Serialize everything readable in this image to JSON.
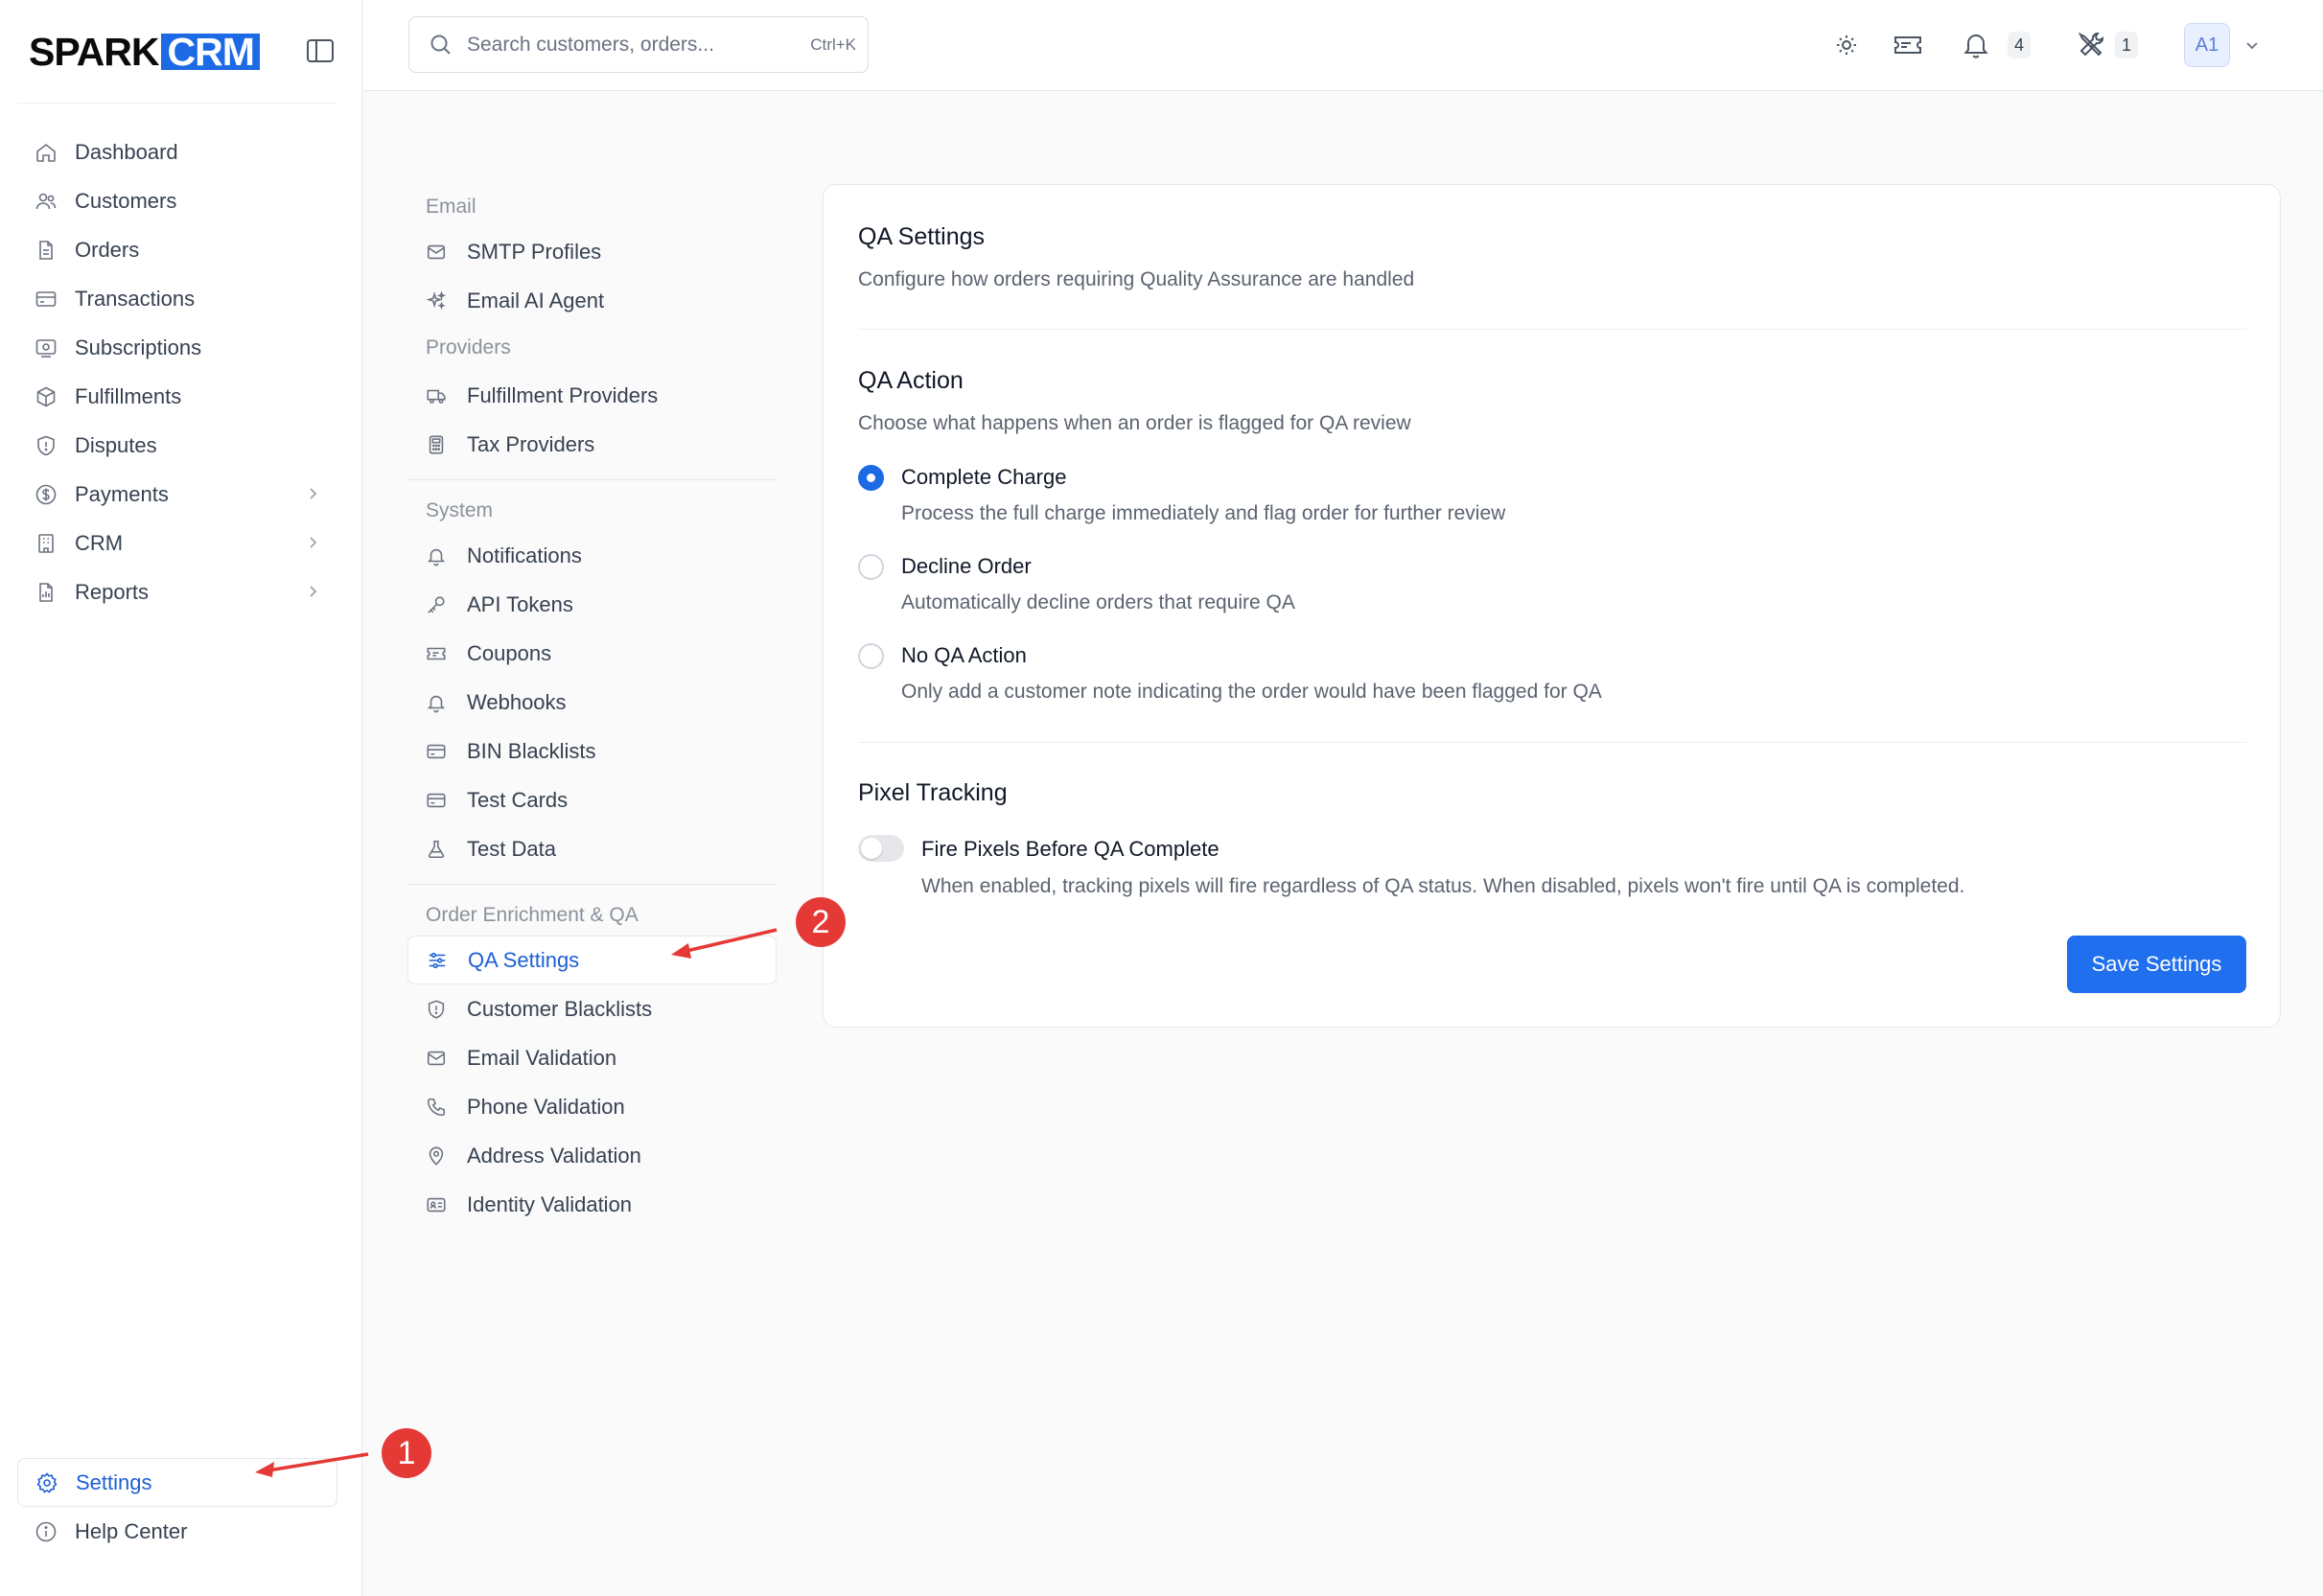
{
  "brand": {
    "logo_left": "SPARK",
    "logo_right": "CRM",
    "accent": "#1d6ae5"
  },
  "sidebar": {
    "items": [
      {
        "label": "Dashboard",
        "icon": "home-icon"
      },
      {
        "label": "Customers",
        "icon": "users-icon"
      },
      {
        "label": "Orders",
        "icon": "file-icon"
      },
      {
        "label": "Transactions",
        "icon": "credit-card-icon"
      },
      {
        "label": "Subscriptions",
        "icon": "refresh-card-icon"
      },
      {
        "label": "Fulfillments",
        "icon": "box-icon"
      },
      {
        "label": "Disputes",
        "icon": "shield-icon"
      },
      {
        "label": "Payments",
        "icon": "dollar-icon",
        "expandable": true
      },
      {
        "label": "CRM",
        "icon": "building-icon",
        "expandable": true
      },
      {
        "label": "Reports",
        "icon": "report-icon",
        "expandable": true
      }
    ],
    "bottom": [
      {
        "label": "Settings",
        "icon": "gear-icon",
        "active": true
      },
      {
        "label": "Help Center",
        "icon": "info-icon"
      }
    ]
  },
  "header": {
    "search_placeholder": "Search customers, orders...",
    "search_shortcut": "Ctrl+K",
    "notifications_count": "4",
    "tools_count": "1",
    "avatar_initials": "A1"
  },
  "settings_nav": {
    "groups": [
      {
        "title": "Email",
        "items": [
          {
            "label": "SMTP Profiles",
            "icon": "mail-icon"
          },
          {
            "label": "Email AI Agent",
            "icon": "sparkles-icon"
          }
        ]
      },
      {
        "title": "Providers",
        "items": [
          {
            "label": "Fulfillment Providers",
            "icon": "truck-icon"
          },
          {
            "label": "Tax Providers",
            "icon": "calculator-icon"
          }
        ]
      },
      {
        "title": "System",
        "items": [
          {
            "label": "Notifications",
            "icon": "bell-icon"
          },
          {
            "label": "API Tokens",
            "icon": "key-icon"
          },
          {
            "label": "Coupons",
            "icon": "ticket-icon"
          },
          {
            "label": "Webhooks",
            "icon": "webhook-icon"
          },
          {
            "label": "BIN Blacklists",
            "icon": "card-icon"
          },
          {
            "label": "Test Cards",
            "icon": "card-icon"
          },
          {
            "label": "Test Data",
            "icon": "flask-icon"
          }
        ]
      },
      {
        "title": "Order Enrichment & QA",
        "items": [
          {
            "label": "QA Settings",
            "icon": "sliders-icon",
            "active": true
          },
          {
            "label": "Customer Blacklists",
            "icon": "shield-icon"
          },
          {
            "label": "Email Validation",
            "icon": "mail-icon"
          },
          {
            "label": "Phone Validation",
            "icon": "phone-icon"
          },
          {
            "label": "Address Validation",
            "icon": "map-pin-icon"
          },
          {
            "label": "Identity Validation",
            "icon": "id-card-icon"
          }
        ]
      }
    ]
  },
  "qa": {
    "title": "QA Settings",
    "description": "Configure how orders requiring Quality Assurance are handled",
    "action_title": "QA Action",
    "action_description": "Choose what happens when an order is flagged for QA review",
    "options": [
      {
        "label": "Complete Charge",
        "description": "Process the full charge immediately and flag order for further review",
        "selected": true
      },
      {
        "label": "Decline Order",
        "description": "Automatically decline orders that require QA",
        "selected": false
      },
      {
        "label": "No QA Action",
        "description": "Only add a customer note indicating the order would have been flagged for QA",
        "selected": false
      }
    ],
    "pixel_title": "Pixel Tracking",
    "pixel_toggle_label": "Fire Pixels Before QA Complete",
    "pixel_toggle_description": "When enabled, tracking pixels will fire regardless of QA status. When disabled, pixels won't fire until QA is completed.",
    "pixel_toggle_on": false,
    "save_label": "Save Settings"
  },
  "annotations": [
    {
      "number": "1"
    },
    {
      "number": "2"
    }
  ]
}
